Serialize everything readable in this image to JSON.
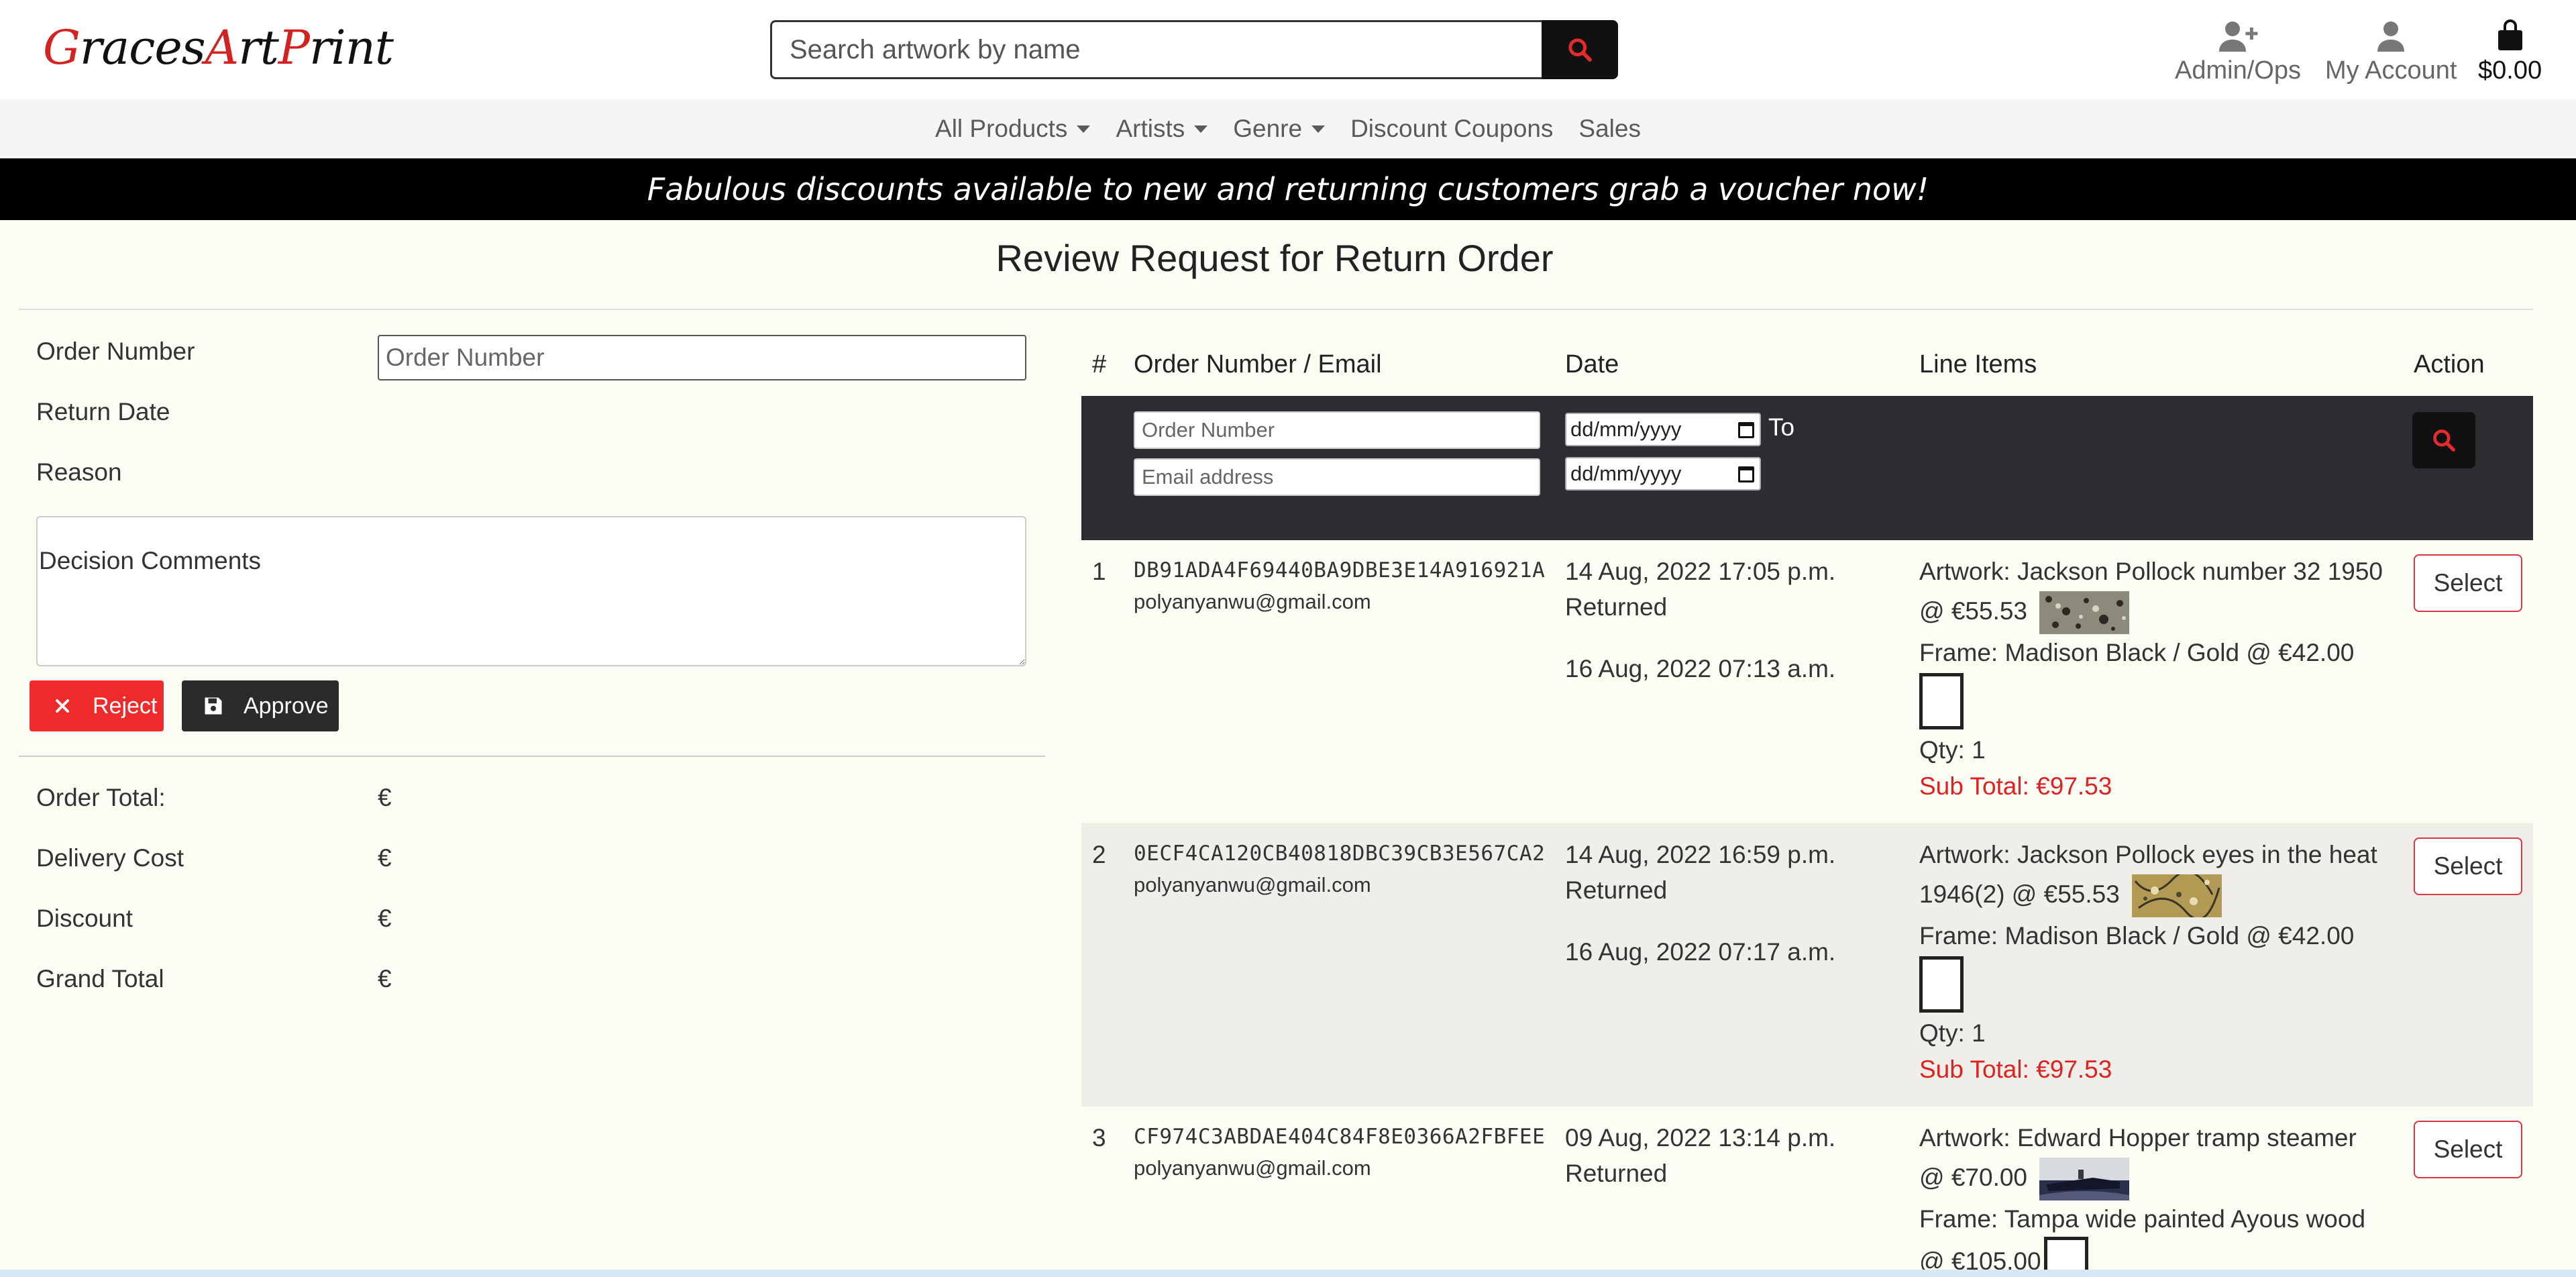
{
  "header": {
    "logo_parts": [
      {
        "text": "Graces",
        "color": "#d32222"
      },
      {
        "text": "Art",
        "color": "#d32222"
      },
      {
        "text": "Print",
        "color": "#d32222"
      }
    ],
    "logo_graces_first": "G",
    "logo_graces_rest": "races",
    "logo_art_first": "A",
    "logo_art_rest": "rt",
    "logo_print_first": "P",
    "logo_print_rest": "rint",
    "search_placeholder": "Search artwork by name",
    "admin_label": "Admin/Ops",
    "account_label": "My Account",
    "cart_total": "$0.00"
  },
  "nav": {
    "all_products": "All Products",
    "artists": "Artists",
    "genre": "Genre",
    "discount_coupons": "Discount Coupons",
    "sales": "Sales"
  },
  "banner": "Fabulous discounts available to new and returning customers grab a voucher now!",
  "page_title": "Review Request for Return Order",
  "form": {
    "order_number_label": "Order Number",
    "order_number_placeholder": "Order Number",
    "return_date_label": "Return Date",
    "reason_label": "Reason",
    "decision_comments_placeholder": "Decision Comments",
    "reject_label": "Reject",
    "approve_label": "Approve",
    "order_total_label": "Order Total:",
    "order_total_value": "€",
    "delivery_cost_label": "Delivery Cost",
    "delivery_cost_value": "€",
    "discount_label": "Discount",
    "discount_value": "€",
    "grand_total_label": "Grand Total",
    "grand_total_value": "€"
  },
  "table": {
    "headers": [
      "#",
      "Order Number / Email",
      "Date",
      "Line Items",
      "Action"
    ],
    "filter": {
      "order_placeholder": "Order Number",
      "email_placeholder": "Email address",
      "date_from": "dd/mm/yyyy",
      "date_to": "dd/mm/yyyy",
      "to_label": "To"
    },
    "rows": [
      {
        "num": "1",
        "order_number": "DB91ADA4F69440BA9DBE3E14A916921A",
        "email": "polyanyanwu@gmail.com",
        "order_date": "14 Aug, 2022 17:05 p.m.",
        "status": "Returned",
        "return_date": "16 Aug, 2022 07:13 a.m.",
        "artwork_line1": "Artwork: Jackson Pollock number 32 1950",
        "artwork_line2": "@ €55.53",
        "frame": "Frame: Madison Black / Gold @ €42.00",
        "qty": "Qty: 1",
        "subtotal": "Sub Total: €97.53",
        "action": "Select"
      },
      {
        "num": "2",
        "order_number": "0ECF4CA120CB40818DBC39CB3E567CA2",
        "email": "polyanyanwu@gmail.com",
        "order_date": "14 Aug, 2022 16:59 p.m.",
        "status": "Returned",
        "return_date": "16 Aug, 2022 07:17 a.m.",
        "artwork_line1": "Artwork: Jackson Pollock eyes in the heat",
        "artwork_line2": "1946(2) @ €55.53",
        "frame": "Frame: Madison Black / Gold @ €42.00",
        "qty": "Qty: 1",
        "subtotal": "Sub Total: €97.53",
        "action": "Select"
      },
      {
        "num": "3",
        "order_number": "CF974C3ABDAE404C84F8E0366A2FBFEE",
        "email": "polyanyanwu@gmail.com",
        "order_date": "09 Aug, 2022 13:14 p.m.",
        "status": "Returned",
        "artwork_line1": "Artwork: Edward Hopper tramp steamer",
        "artwork_line2": "@ €70.00",
        "frame": "Frame: Tampa wide painted Ayous wood",
        "frame_price": "@ €105.00",
        "action": "Select"
      }
    ]
  },
  "colors": {
    "brand_red": "#d32222",
    "dark": "#2b2d31",
    "reject": "#ef2a2a",
    "subtotal": "#dd2222"
  }
}
